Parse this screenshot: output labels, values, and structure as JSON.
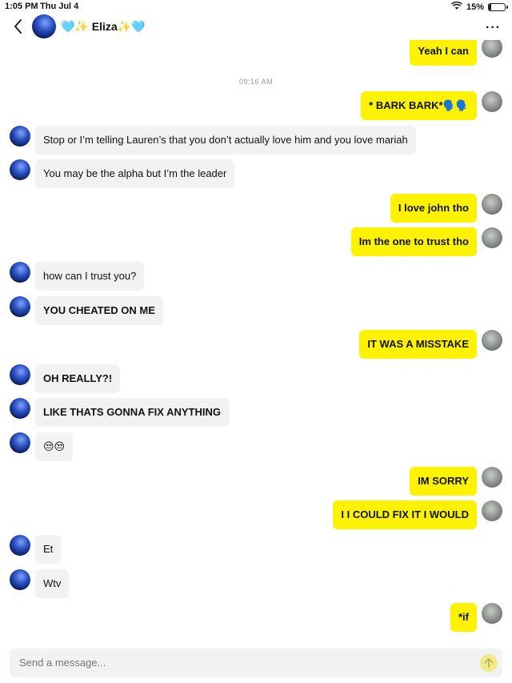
{
  "status_bar": {
    "time": "1:05 PM",
    "date": "Thu Jul 4",
    "battery_text": "15%",
    "battery_level": 0.15
  },
  "header": {
    "contact_name": "🩵✨ Eliza✨🩵",
    "more_label": "···"
  },
  "timestamp": "09:16 AM",
  "messages": [
    {
      "text": "Yeah I can",
      "direction": "out"
    },
    {
      "text": "* BARK BARK*🗣️🗣️",
      "direction": "out"
    },
    {
      "text": "Stop or I’m telling Lauren’s that you don’t actually love him and you love mariah",
      "direction": "in"
    },
    {
      "text": "You may be the alpha but I’m the leader",
      "direction": "in"
    },
    {
      "text": "I love john tho",
      "direction": "out"
    },
    {
      "text": "Im the one to trust tho",
      "direction": "out"
    },
    {
      "text": "how can I trust you?",
      "direction": "in"
    },
    {
      "text": "YOU CHEATED ON ME",
      "direction": "in"
    },
    {
      "text": "IT WAS A MISSTAKE",
      "direction": "out"
    },
    {
      "text": "OH REALLY?!",
      "direction": "in"
    },
    {
      "text": "LIKE THATS GONNA FIX ANYTHING",
      "direction": "in"
    },
    {
      "text": "😒😒",
      "direction": "in"
    },
    {
      "text": "IM SORRY",
      "direction": "out"
    },
    {
      "text": "I I COULD FIX IT I  WOULD",
      "direction": "out"
    },
    {
      "text": "Et",
      "direction": "in"
    },
    {
      "text": "Wtv",
      "direction": "in"
    },
    {
      "text": "*if",
      "direction": "out"
    }
  ],
  "composer": {
    "placeholder": "Send a message..."
  },
  "colors": {
    "outgoing_bubble": "#fdf200",
    "incoming_bubble": "#f2f2f2"
  }
}
